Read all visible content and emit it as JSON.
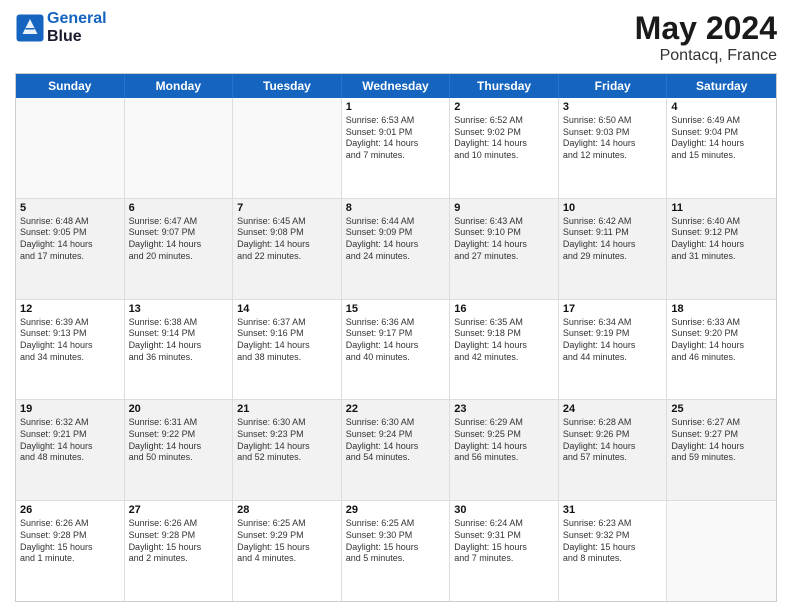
{
  "header": {
    "logo_line1": "General",
    "logo_line2": "Blue",
    "month": "May 2024",
    "location": "Pontacq, France"
  },
  "days_of_week": [
    "Sunday",
    "Monday",
    "Tuesday",
    "Wednesday",
    "Thursday",
    "Friday",
    "Saturday"
  ],
  "rows": [
    [
      {
        "day": "",
        "lines": [],
        "empty": true
      },
      {
        "day": "",
        "lines": [],
        "empty": true
      },
      {
        "day": "",
        "lines": [],
        "empty": true
      },
      {
        "day": "1",
        "lines": [
          "Sunrise: 6:53 AM",
          "Sunset: 9:01 PM",
          "Daylight: 14 hours",
          "and 7 minutes."
        ]
      },
      {
        "day": "2",
        "lines": [
          "Sunrise: 6:52 AM",
          "Sunset: 9:02 PM",
          "Daylight: 14 hours",
          "and 10 minutes."
        ]
      },
      {
        "day": "3",
        "lines": [
          "Sunrise: 6:50 AM",
          "Sunset: 9:03 PM",
          "Daylight: 14 hours",
          "and 12 minutes."
        ]
      },
      {
        "day": "4",
        "lines": [
          "Sunrise: 6:49 AM",
          "Sunset: 9:04 PM",
          "Daylight: 14 hours",
          "and 15 minutes."
        ]
      }
    ],
    [
      {
        "day": "5",
        "lines": [
          "Sunrise: 6:48 AM",
          "Sunset: 9:05 PM",
          "Daylight: 14 hours",
          "and 17 minutes."
        ]
      },
      {
        "day": "6",
        "lines": [
          "Sunrise: 6:47 AM",
          "Sunset: 9:07 PM",
          "Daylight: 14 hours",
          "and 20 minutes."
        ]
      },
      {
        "day": "7",
        "lines": [
          "Sunrise: 6:45 AM",
          "Sunset: 9:08 PM",
          "Daylight: 14 hours",
          "and 22 minutes."
        ]
      },
      {
        "day": "8",
        "lines": [
          "Sunrise: 6:44 AM",
          "Sunset: 9:09 PM",
          "Daylight: 14 hours",
          "and 24 minutes."
        ]
      },
      {
        "day": "9",
        "lines": [
          "Sunrise: 6:43 AM",
          "Sunset: 9:10 PM",
          "Daylight: 14 hours",
          "and 27 minutes."
        ]
      },
      {
        "day": "10",
        "lines": [
          "Sunrise: 6:42 AM",
          "Sunset: 9:11 PM",
          "Daylight: 14 hours",
          "and 29 minutes."
        ]
      },
      {
        "day": "11",
        "lines": [
          "Sunrise: 6:40 AM",
          "Sunset: 9:12 PM",
          "Daylight: 14 hours",
          "and 31 minutes."
        ]
      }
    ],
    [
      {
        "day": "12",
        "lines": [
          "Sunrise: 6:39 AM",
          "Sunset: 9:13 PM",
          "Daylight: 14 hours",
          "and 34 minutes."
        ]
      },
      {
        "day": "13",
        "lines": [
          "Sunrise: 6:38 AM",
          "Sunset: 9:14 PM",
          "Daylight: 14 hours",
          "and 36 minutes."
        ]
      },
      {
        "day": "14",
        "lines": [
          "Sunrise: 6:37 AM",
          "Sunset: 9:16 PM",
          "Daylight: 14 hours",
          "and 38 minutes."
        ]
      },
      {
        "day": "15",
        "lines": [
          "Sunrise: 6:36 AM",
          "Sunset: 9:17 PM",
          "Daylight: 14 hours",
          "and 40 minutes."
        ]
      },
      {
        "day": "16",
        "lines": [
          "Sunrise: 6:35 AM",
          "Sunset: 9:18 PM",
          "Daylight: 14 hours",
          "and 42 minutes."
        ]
      },
      {
        "day": "17",
        "lines": [
          "Sunrise: 6:34 AM",
          "Sunset: 9:19 PM",
          "Daylight: 14 hours",
          "and 44 minutes."
        ]
      },
      {
        "day": "18",
        "lines": [
          "Sunrise: 6:33 AM",
          "Sunset: 9:20 PM",
          "Daylight: 14 hours",
          "and 46 minutes."
        ]
      }
    ],
    [
      {
        "day": "19",
        "lines": [
          "Sunrise: 6:32 AM",
          "Sunset: 9:21 PM",
          "Daylight: 14 hours",
          "and 48 minutes."
        ]
      },
      {
        "day": "20",
        "lines": [
          "Sunrise: 6:31 AM",
          "Sunset: 9:22 PM",
          "Daylight: 14 hours",
          "and 50 minutes."
        ]
      },
      {
        "day": "21",
        "lines": [
          "Sunrise: 6:30 AM",
          "Sunset: 9:23 PM",
          "Daylight: 14 hours",
          "and 52 minutes."
        ]
      },
      {
        "day": "22",
        "lines": [
          "Sunrise: 6:30 AM",
          "Sunset: 9:24 PM",
          "Daylight: 14 hours",
          "and 54 minutes."
        ]
      },
      {
        "day": "23",
        "lines": [
          "Sunrise: 6:29 AM",
          "Sunset: 9:25 PM",
          "Daylight: 14 hours",
          "and 56 minutes."
        ]
      },
      {
        "day": "24",
        "lines": [
          "Sunrise: 6:28 AM",
          "Sunset: 9:26 PM",
          "Daylight: 14 hours",
          "and 57 minutes."
        ]
      },
      {
        "day": "25",
        "lines": [
          "Sunrise: 6:27 AM",
          "Sunset: 9:27 PM",
          "Daylight: 14 hours",
          "and 59 minutes."
        ]
      }
    ],
    [
      {
        "day": "26",
        "lines": [
          "Sunrise: 6:26 AM",
          "Sunset: 9:28 PM",
          "Daylight: 15 hours",
          "and 1 minute."
        ]
      },
      {
        "day": "27",
        "lines": [
          "Sunrise: 6:26 AM",
          "Sunset: 9:28 PM",
          "Daylight: 15 hours",
          "and 2 minutes."
        ]
      },
      {
        "day": "28",
        "lines": [
          "Sunrise: 6:25 AM",
          "Sunset: 9:29 PM",
          "Daylight: 15 hours",
          "and 4 minutes."
        ]
      },
      {
        "day": "29",
        "lines": [
          "Sunrise: 6:25 AM",
          "Sunset: 9:30 PM",
          "Daylight: 15 hours",
          "and 5 minutes."
        ]
      },
      {
        "day": "30",
        "lines": [
          "Sunrise: 6:24 AM",
          "Sunset: 9:31 PM",
          "Daylight: 15 hours",
          "and 7 minutes."
        ]
      },
      {
        "day": "31",
        "lines": [
          "Sunrise: 6:23 AM",
          "Sunset: 9:32 PM",
          "Daylight: 15 hours",
          "and 8 minutes."
        ]
      },
      {
        "day": "",
        "lines": [],
        "empty": true
      }
    ]
  ]
}
